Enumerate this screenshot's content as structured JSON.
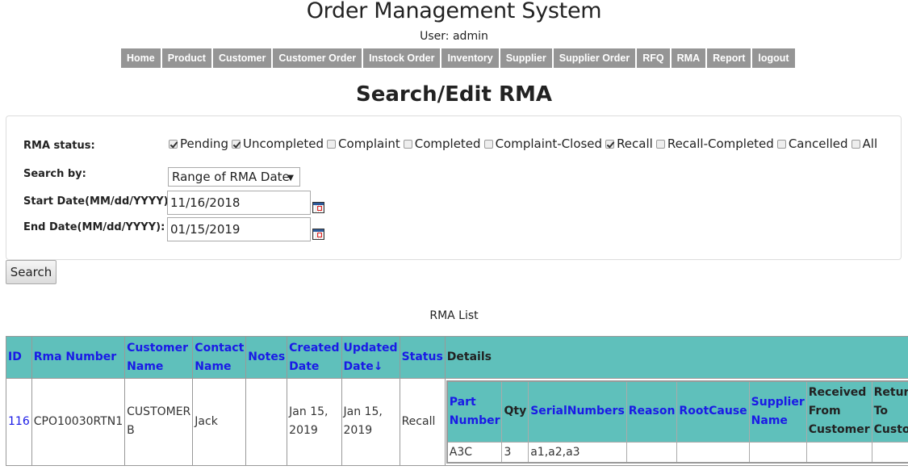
{
  "header": {
    "app_title": "Order Management System",
    "user_line": "User: admin"
  },
  "nav": [
    {
      "label": "Home"
    },
    {
      "label": "Product"
    },
    {
      "label": "Customer"
    },
    {
      "label": "Customer Order"
    },
    {
      "label": "Instock Order"
    },
    {
      "label": "Inventory"
    },
    {
      "label": "Supplier"
    },
    {
      "label": "Supplier Order"
    },
    {
      "label": "RFQ"
    },
    {
      "label": "RMA"
    },
    {
      "label": "Report"
    },
    {
      "label": "logout"
    }
  ],
  "page_title": "Search/Edit RMA",
  "form": {
    "status_label": "RMA status:",
    "statuses": [
      {
        "label": "Pending",
        "checked": true
      },
      {
        "label": "Uncompleted",
        "checked": true
      },
      {
        "label": "Complaint",
        "checked": false
      },
      {
        "label": "Completed",
        "checked": false
      },
      {
        "label": "Complaint-Closed",
        "checked": false
      },
      {
        "label": "Recall",
        "checked": true
      },
      {
        "label": "Recall-Completed",
        "checked": false
      },
      {
        "label": "Cancelled",
        "checked": false
      },
      {
        "label": "All",
        "checked": false
      }
    ],
    "search_by_label": "Search by:",
    "search_by_value": "Range of RMA Date",
    "start_date_label": "Start Date(MM/dd/YYYY):",
    "start_date_value": "11/16/2018",
    "end_date_label": "End Date(MM/dd/YYYY):",
    "end_date_value": "01/15/2019",
    "search_button": "Search"
  },
  "list": {
    "caption": "RMA List",
    "columns": [
      "ID",
      "Rma Number",
      "Customer Name",
      "Contact Name",
      "Notes",
      "Created Date",
      "Updated Date↓",
      "Status",
      "Details"
    ],
    "rows": [
      {
        "id": "116",
        "rma_number": "CPO10030RTN1",
        "customer_name": "CUSTOMER B",
        "contact_name": "Jack",
        "notes": "",
        "created_date": "Jan 15, 2019",
        "updated_date": "Jan 15, 2019",
        "status": "Recall",
        "details": {
          "columns": [
            "Part Number",
            "Qty",
            "SerialNumbers",
            "Reason",
            "RootCause",
            "Supplier Name",
            "Received From Customer",
            "Return To Customer"
          ],
          "rows": [
            {
              "part_number": "A3C",
              "qty": "3",
              "serial_numbers": "a1,a2,a3",
              "reason": "",
              "root_cause": "",
              "supplier_name": "",
              "received_from_customer": "",
              "return_to_customer": ""
            }
          ]
        }
      }
    ]
  }
}
